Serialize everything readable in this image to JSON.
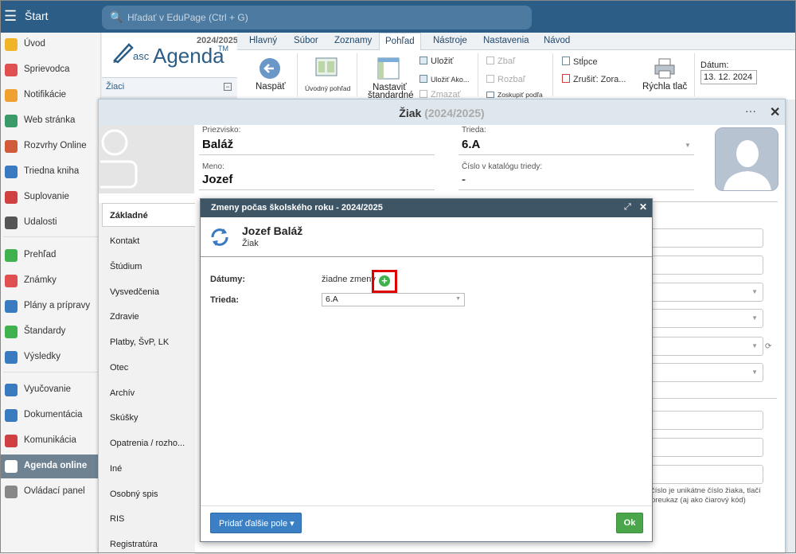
{
  "topbar": {
    "menu_icon": "hamburger-icon",
    "start_label": "Štart",
    "search_placeholder": "Hľadať v EduPage (Ctrl + G)"
  },
  "sidebar": {
    "items": [
      {
        "label": "Úvod",
        "icon": "star-icon",
        "color": "#f0b429"
      },
      {
        "label": "Sprievodca",
        "icon": "wand-icon",
        "color": "#e05050"
      },
      {
        "label": "Notifikácie",
        "icon": "envelope-icon",
        "color": "#f0a030"
      },
      {
        "label": "Web stránka",
        "icon": "home-icon",
        "color": "#3a9a6a"
      },
      {
        "label": "Rozvrhy Online",
        "icon": "grid-icon",
        "color": "#d05a3a"
      },
      {
        "label": "Triedna kniha",
        "icon": "book-icon",
        "color": "#3a7ac0"
      },
      {
        "label": "Suplovanie",
        "icon": "person-icon",
        "color": "#d04040"
      },
      {
        "label": "Udalosti",
        "icon": "calendar-icon",
        "color": "#555555"
      },
      {
        "label": "Prehľad",
        "icon": "check-circle-icon",
        "color": "#3fb24d"
      },
      {
        "label": "Známky",
        "icon": "grade-icon",
        "color": "#e05050"
      },
      {
        "label": "Plány a prípravy",
        "icon": "briefcase-icon",
        "color": "#3a7ac0"
      },
      {
        "label": "Štandardy",
        "icon": "shield-icon",
        "color": "#3fb24d"
      },
      {
        "label": "Výsledky",
        "icon": "bar-chart-icon",
        "color": "#3a7ac0"
      },
      {
        "label": "Vyučovanie",
        "icon": "open-book-icon",
        "color": "#3a7ac0"
      },
      {
        "label": "Dokumentácia",
        "icon": "document-icon",
        "color": "#3a7ac0"
      },
      {
        "label": "Komunikácia",
        "icon": "chat-icon",
        "color": "#d04040"
      },
      {
        "label": "Agenda online",
        "icon": "pen-icon",
        "color": "#ffffff"
      },
      {
        "label": "Ovládací panel",
        "icon": "gear-icon",
        "color": "#888888"
      }
    ]
  },
  "logo": {
    "year": "2024/2025",
    "asc": "asc",
    "agenda": "Agenda",
    "tm": "TM",
    "list_label": "Žiaci",
    "collapse": "−"
  },
  "ribbon": {
    "tabs": [
      "Hlavný",
      "Súbor",
      "Zoznamy",
      "Pohľad",
      "Nástroje",
      "Nastavenia",
      "Návod"
    ],
    "active_tab": "Pohľad",
    "back": "Naspäť",
    "home_view": "Úvodný pohľad",
    "set_default_1": "Nastaviť",
    "set_default_2": "štandardné",
    "save": "Uložiť",
    "save_as": "Uložiť Ako...",
    "delete": "Zmazať",
    "collapse": "Zbaľ",
    "expand": "Rozbaľ",
    "group_by": "Zoskupiť podľa",
    "columns": "Stĺpce",
    "cancel_sort": "Zrušiť: Zora...",
    "quick_print": "Rýchla tlač",
    "date_label": "Dátum:",
    "date_value": "13. 12. 2024"
  },
  "student": {
    "title": "Žiak",
    "title_year": "(2024/2025)",
    "more": "···",
    "close": "✕",
    "surname_label": "Priezvisko:",
    "surname": "Baláž",
    "name_label": "Meno:",
    "name": "Jozef",
    "class_label": "Trieda:",
    "class": "6.A",
    "catalog_label": "Číslo v katalógu triedy:",
    "catalog": "-",
    "help_1": "číslo je unikátne číslo žiaka, tlačí",
    "help_2": "preukaz (aj ako čiarový kód)"
  },
  "tabs": [
    "Základné",
    "Kontakt",
    "Štúdium",
    "Vysvedčenia",
    "Zdravie",
    "Platby, ŠvP, LK",
    "Otec",
    "Archív",
    "Skúšky",
    "Opatrenia / rozho...",
    "Iné",
    "Osobný spis",
    "RIS",
    "Registratúra"
  ],
  "modal": {
    "title": "Zmeny počas školského roku - 2024/2025",
    "expand": "⤢",
    "close": "✕",
    "person_name": "Jozef Baláž",
    "person_role": "Žiak",
    "dates_label": "Dátumy:",
    "dates_value": "žiadne zmeny",
    "class_label": "Trieda:",
    "class_value": "6.A",
    "add_fields": "Pridať ďalšie pole ▾",
    "ok": "Ok"
  }
}
